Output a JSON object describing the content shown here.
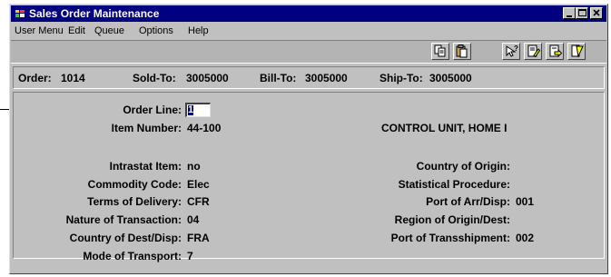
{
  "window": {
    "title": "Sales Order Maintenance"
  },
  "menu": [
    {
      "label": "User Menu"
    },
    {
      "label": "Edit"
    },
    {
      "label": "Queue"
    },
    {
      "label": "Options"
    },
    {
      "label": "Help"
    }
  ],
  "toolbar": {
    "buttons": [
      "copy-icon",
      "paste-icon",
      "help-pointer-icon",
      "edit-doc-icon",
      "next-doc-icon",
      "exit-icon"
    ]
  },
  "header": {
    "order_label": "Order:",
    "order_value": "1014",
    "sold_to_label": "Sold-To:",
    "sold_to_value": "3005000",
    "bill_to_label": "Bill-To:",
    "bill_to_value": "3005000",
    "ship_to_label": "Ship-To:",
    "ship_to_value": "3005000"
  },
  "detail": {
    "order_line_label": "Order Line:",
    "order_line_value": "1",
    "item_number_label": "Item Number:",
    "item_number_value": "44-100",
    "item_description": "CONTROL UNIT, HOME I",
    "intrastat_item_label": "Intrastat Item:",
    "intrastat_item_value": "no",
    "commodity_code_label": "Commodity Code:",
    "commodity_code_value": "Elec",
    "terms_of_delivery_label": "Terms of Delivery:",
    "terms_of_delivery_value": "CFR",
    "nature_of_transaction_label": "Nature of Transaction:",
    "nature_of_transaction_value": "04",
    "country_of_dest_label": "Country of Dest/Disp:",
    "country_of_dest_value": "FRA",
    "mode_of_transport_label": "Mode of Transport:",
    "mode_of_transport_value": "7",
    "country_of_origin_label": "Country of Origin:",
    "country_of_origin_value": "",
    "statistical_procedure_label": "Statistical Procedure:",
    "statistical_procedure_value": "",
    "port_of_arr_label": "Port of Arr/Disp:",
    "port_of_arr_value": "001",
    "region_of_origin_label": "Region of Origin/Dest:",
    "region_of_origin_value": "",
    "port_of_transshipment_label": "Port of Transshipment:",
    "port_of_transshipment_value": "002"
  }
}
